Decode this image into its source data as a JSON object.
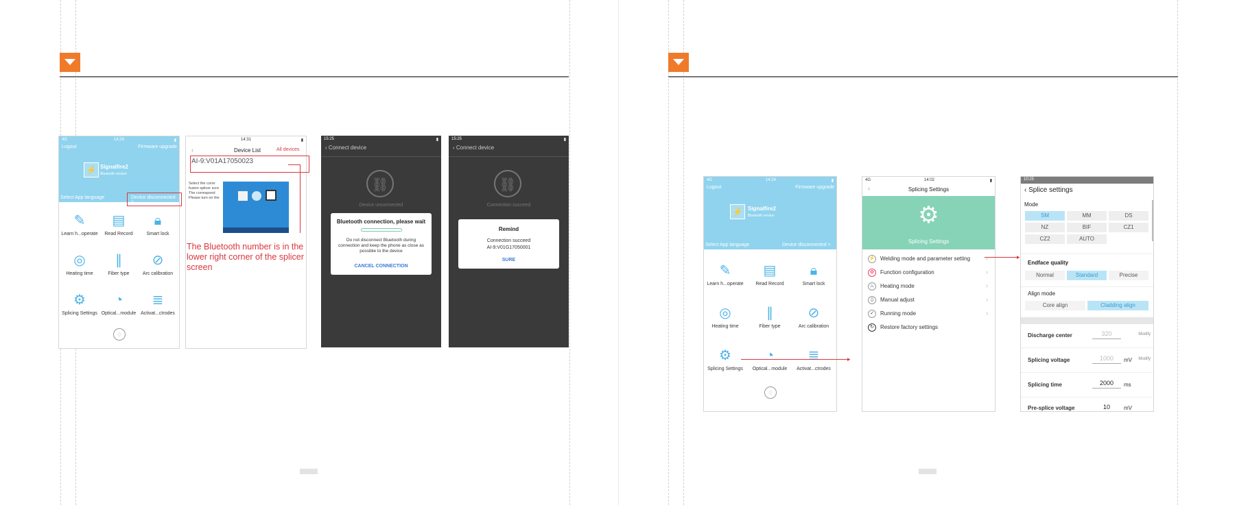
{
  "colors": {
    "accent": "#ef7b2a",
    "app_blue": "#8fd3ee",
    "icon_blue": "#4db4e6",
    "highlight_red": "#d9363e",
    "teal_banner": "#86d3b8"
  },
  "screen_home": {
    "status_left": "4G",
    "status_time": "14:24",
    "header_left": "Logout",
    "header_right": "Firmware upgrade",
    "app_name": "Signalfire2",
    "app_sub": "Bluetooth version",
    "lang_label": "Select App language",
    "device_status": "Device disconnected >",
    "grid": [
      {
        "label": "Learn h...operate",
        "icon": "book-icon"
      },
      {
        "label": "Read Record",
        "icon": "records-icon"
      },
      {
        "label": "Smart lock",
        "icon": "lock-icon"
      },
      {
        "label": "Heating time",
        "icon": "heat-icon"
      },
      {
        "label": "Fiber type",
        "icon": "fiber-icon"
      },
      {
        "label": "Arc calibration",
        "icon": "arc-icon"
      },
      {
        "label": "Splicing Settings",
        "icon": "settings-icon"
      },
      {
        "label": "Optical...module",
        "icon": "gauge-icon"
      },
      {
        "label": "Activat...ctrodes",
        "icon": "electrode-icon"
      }
    ]
  },
  "screen_device_list": {
    "status_time": "14:31",
    "title": "Device List",
    "right_action": "All devices",
    "device_name": "AI-9:V01A17050023",
    "instruction_lines": [
      "Select the corre",
      "fusion splicer scre",
      "The correspond",
      "Please turn on the"
    ],
    "note": "The Bluetooth number is in the lower right corner of the splicer screen"
  },
  "screen_connecting": {
    "status_time": "15:25",
    "header": "Connect device",
    "state": "Device unconnected",
    "dialog_title": "Bluetooth connection, please wait",
    "dialog_body": "Do not disconnect Bluetooth during connection and keep the phone as close as possible to the device",
    "dialog_button": "CANCEL CONNECTION"
  },
  "screen_connected": {
    "status_time": "15:25",
    "header": "Connect device",
    "state": "Connection succeed",
    "dialog_title": "Remind",
    "dialog_body_1": "Connection succeed",
    "dialog_body_2": "AI-9:V01G17050001",
    "dialog_button": "SURE"
  },
  "screen_splicing": {
    "status_left": "4G",
    "status_time": "14:02",
    "title": "Splicing Settings",
    "banner_label": "Splicing Settings",
    "items": [
      "Welding mode and parameter setting",
      "Function configuration",
      "Heating mode",
      "Manual adjust",
      "Running mode",
      "Restore factory settings"
    ]
  },
  "screen_splice": {
    "status_time": "10:25",
    "title": "Splice settings",
    "mode_label": "Mode",
    "modes": [
      "SM",
      "MM",
      "DS",
      "NZ",
      "BIF",
      "CZ1",
      "CZ2",
      "AUTO"
    ],
    "mode_selected": "SM",
    "endface_label": "Endface quality",
    "endface": [
      "Normal",
      "Standard",
      "Precise"
    ],
    "endface_selected": "Standard",
    "align_label": "Align mode",
    "align": [
      "Core align",
      "Cladding align"
    ],
    "align_selected": "Cladding align",
    "params": [
      {
        "name": "Discharge center",
        "value": "320",
        "unit": "",
        "modify": "Modify"
      },
      {
        "name": "Splicing voltage",
        "value": "1000",
        "unit": "mV",
        "modify": "Modify"
      },
      {
        "name": "Splicing time",
        "value": "2000",
        "unit": "ms",
        "modify": ""
      },
      {
        "name": "Pre-splice voltage",
        "value": "10",
        "unit": "mV",
        "modify": ""
      }
    ]
  }
}
